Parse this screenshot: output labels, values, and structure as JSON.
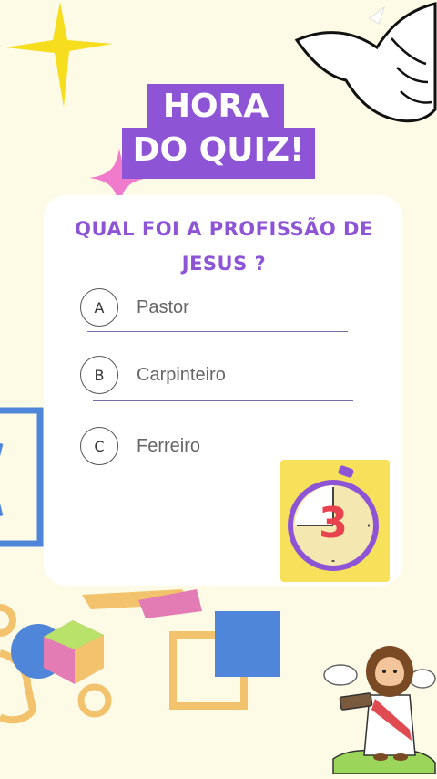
{
  "title": {
    "line1": "HORA",
    "line2": "DO QUIZ!"
  },
  "question": "QUAL FOI A PROFISSÃO DE JESUS ?",
  "options": [
    {
      "letter": "A",
      "text": "Pastor"
    },
    {
      "letter": "B",
      "text": "Carpinteiro"
    },
    {
      "letter": "C",
      "text": "Ferreiro"
    }
  ],
  "timer": {
    "value": "3",
    "icon": "stopwatch-icon"
  },
  "colors": {
    "background": "#fdfbe6",
    "accent_purple": "#8e54d6",
    "timer_yellow": "#f8e15a",
    "star_yellow": "#f6dd1e",
    "sparkle_pink": "#f07acb",
    "hexagon_blue": "#4f86d9",
    "shape_orange": "#f2c26c",
    "shape_pink": "#e37cb4"
  },
  "decorations": [
    "yellow-star-icon",
    "pink-sparkle-icon",
    "dove-icon",
    "jesus-character-icon",
    "cloud-icon"
  ]
}
